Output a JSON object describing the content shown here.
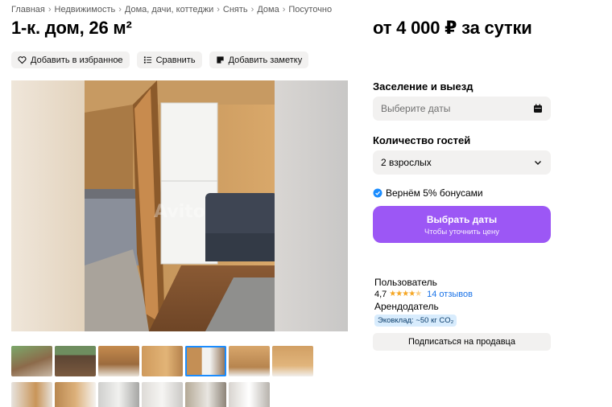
{
  "breadcrumbs": [
    "Главная",
    "Недвижимость",
    "Дома, дачи, коттеджи",
    "Снять",
    "Дома",
    "Посуточно"
  ],
  "title": "1-к. дом, 26 м²",
  "price": "от 4 000 ₽ за сутки",
  "actions": {
    "favorite": "Добавить в избранное",
    "compare": "Сравнить",
    "note": "Добавить заметку"
  },
  "gallery": {
    "watermark": "Avito",
    "thumbnail_count": 13,
    "active_thumbnail": 4
  },
  "booking": {
    "dates_label": "Заселение и выезд",
    "dates_placeholder": "Выберите даты",
    "guests_label": "Количество гостей",
    "guests_value": "2 взрослых",
    "bonus_text": "Вернём 5% бонусами",
    "cta_main": "Выбрать даты",
    "cta_sub": "Чтобы уточнить цену"
  },
  "seller": {
    "name": "Пользователь",
    "rating": "4,7",
    "stars": 4.7,
    "reviews": "14 отзывов",
    "role": "Арендодатель",
    "eco": "Эковклад: ~50 кг CO₂"
  },
  "subscribe_label": "Подписаться на продавца",
  "colors": {
    "accent": "#9c57f5",
    "link": "#1a73e8",
    "star": "#f5a623"
  }
}
